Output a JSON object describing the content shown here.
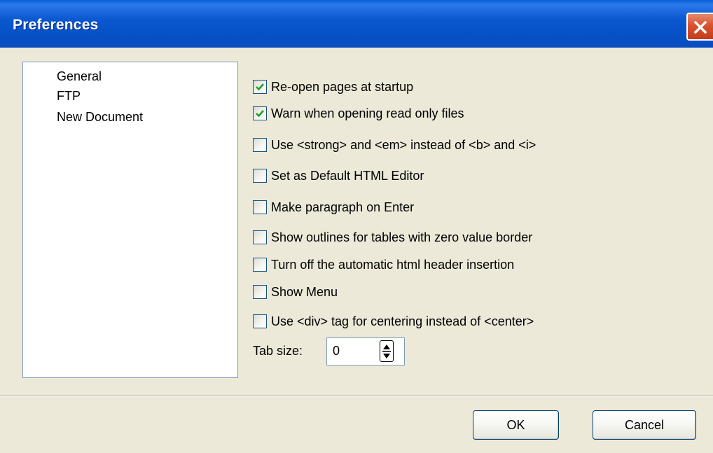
{
  "window": {
    "title": "Preferences"
  },
  "sidebar": {
    "items": [
      "General",
      "FTP",
      "New Document"
    ]
  },
  "options": [
    {
      "label": "Re-open pages at startup",
      "checked": true
    },
    {
      "label": "Warn when opening read only files",
      "checked": true
    },
    {
      "label": "Use <strong> and <em> instead of <b> and <i>",
      "checked": false
    },
    {
      "label": "Set as Default HTML Editor",
      "checked": false
    },
    {
      "label": "Make paragraph on Enter",
      "checked": false
    },
    {
      "label": "Show outlines for tables with zero value border",
      "checked": false
    },
    {
      "label": "Turn off the automatic html header insertion",
      "checked": false
    },
    {
      "label": "Show Menu",
      "checked": false
    },
    {
      "label": "Use <div> tag for centering instead of <center>",
      "checked": false
    }
  ],
  "tab_size": {
    "label": "Tab size:",
    "value": "0"
  },
  "buttons": {
    "ok": "OK",
    "cancel": "Cancel"
  },
  "colors": {
    "titlebar": "#0b58d0",
    "close_button": "#d8522f",
    "dialog_bg": "#ece9d8",
    "checkmark": "#21a121"
  }
}
